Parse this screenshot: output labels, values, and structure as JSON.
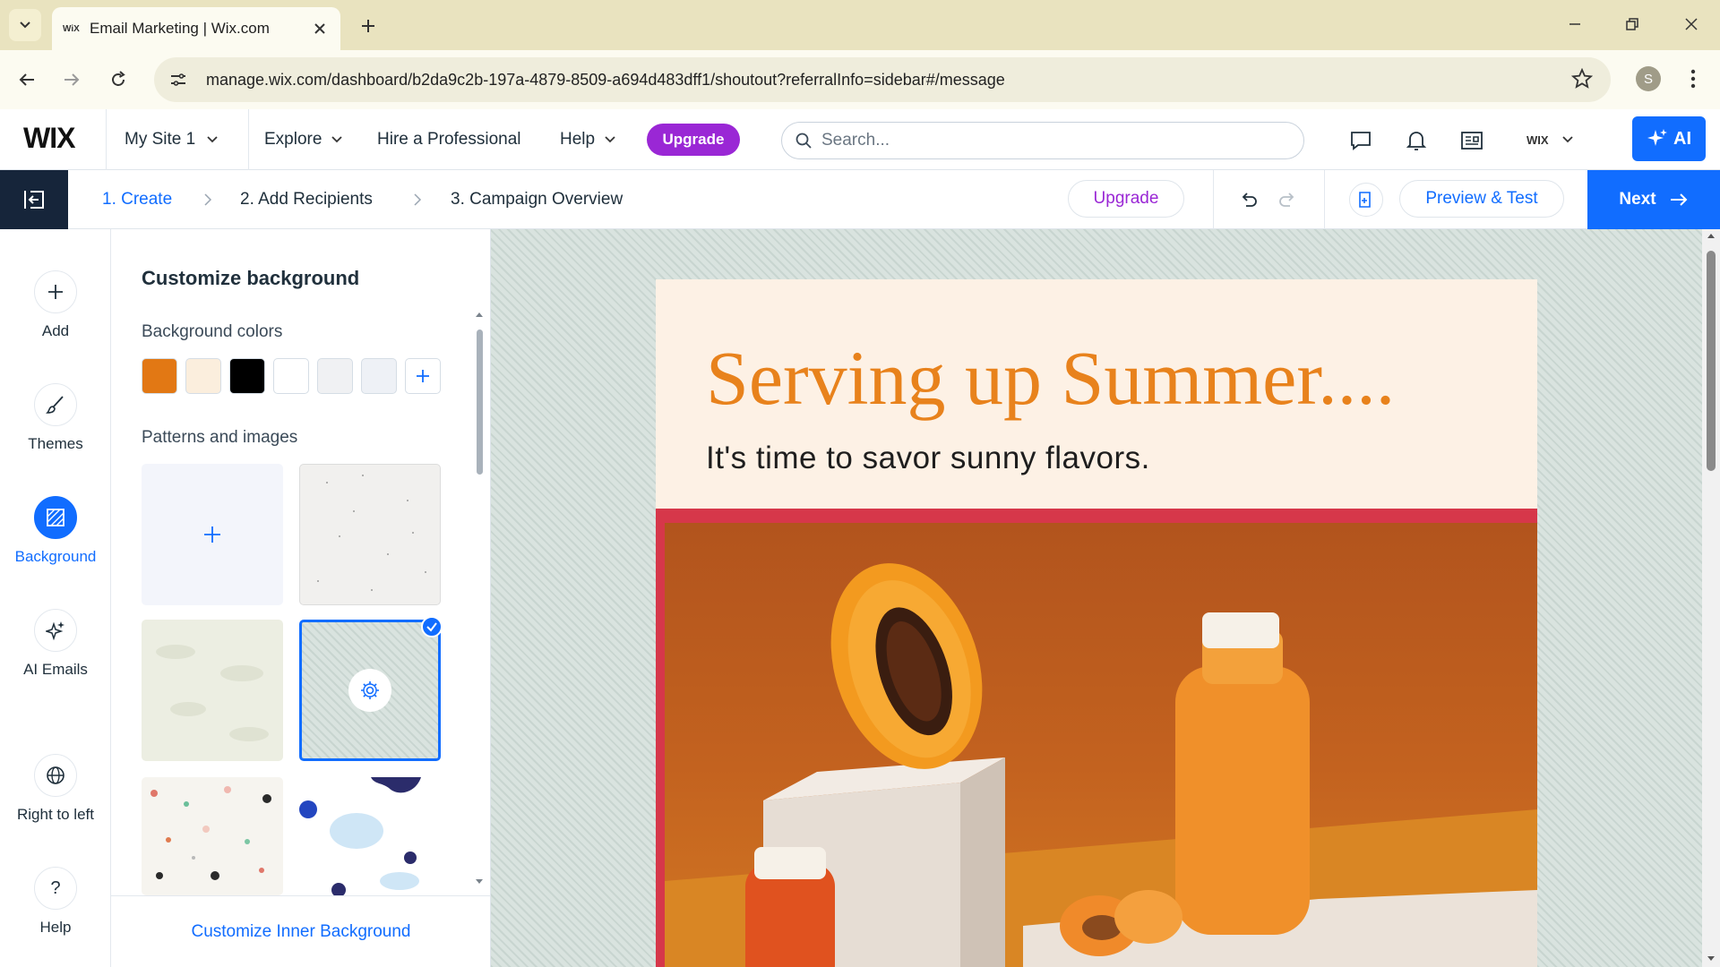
{
  "browser": {
    "tab_title": "Email Marketing | Wix.com",
    "tab_favicon": "WiX",
    "url": "manage.wix.com/dashboard/b2da9c2b-197a-4879-8509-a694d483dff1/shoutout?referralInfo=sidebar#/message",
    "profile_initial": "S"
  },
  "wix_topbar": {
    "logo": "WIX",
    "site_name": "My Site 1",
    "nav": {
      "explore": "Explore",
      "hire": "Hire a Professional",
      "help": "Help"
    },
    "upgrade_label": "Upgrade",
    "search_placeholder": "Search...",
    "account_label": "WIX",
    "ai_label": "AI"
  },
  "steps": {
    "items": [
      "1. Create",
      "2. Add Recipients",
      "3. Campaign Overview"
    ],
    "active_index": 0,
    "upgrade_label": "Upgrade",
    "preview_label": "Preview & Test",
    "next_label": "Next"
  },
  "rail": {
    "items": [
      {
        "label": "Add",
        "icon": "plus-icon"
      },
      {
        "label": "Themes",
        "icon": "brush-icon"
      },
      {
        "label": "Background",
        "icon": "background-icon",
        "active": true
      },
      {
        "label": "AI Emails",
        "icon": "sparkle-icon"
      },
      {
        "label": "Right to left",
        "icon": "globe-icon"
      },
      {
        "label": "Help",
        "icon": "question-icon"
      }
    ]
  },
  "panel": {
    "title": "Customize background",
    "colors_label": "Background colors",
    "colors": [
      "#e27814",
      "#fbeedd",
      "#000000",
      "#ffffff",
      "#f0f1f3",
      "#eef1f6"
    ],
    "patterns_label": "Patterns and images",
    "selected_pattern_index": 3,
    "footer_link": "Customize Inner Background"
  },
  "email": {
    "headline": "Serving up Summer....",
    "subheadline": "It's time to savor sunny flavors."
  },
  "colors": {
    "accent": "#116dff",
    "upgrade_purple": "#9a27d5",
    "headline_orange": "#e8821c",
    "hero_border": "#d6374a"
  }
}
